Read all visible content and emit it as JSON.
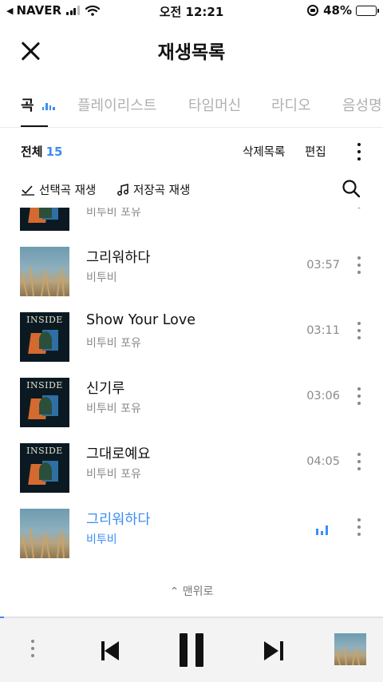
{
  "status_bar": {
    "carrier": "NAVER",
    "time": "오전 12:21",
    "battery": "48%",
    "battery_level": 0.48
  },
  "header": {
    "title": "재생목록"
  },
  "tabs": [
    {
      "label": "곡",
      "active": true
    },
    {
      "label": "플레이리스트",
      "active": false
    },
    {
      "label": "타임머신",
      "active": false
    },
    {
      "label": "라디오",
      "active": false
    },
    {
      "label": "음성명령",
      "active": false
    }
  ],
  "list_header": {
    "total_label": "전체",
    "total_count": "15",
    "delete_list_label": "삭제목록",
    "edit_label": "편집"
  },
  "actions": {
    "play_selected_label": "선택곡 재생",
    "play_saved_label": "저장곡 재생"
  },
  "tracks": [
    {
      "title": "",
      "artist": "비투비 포유",
      "duration": "",
      "art": "inside"
    },
    {
      "title": "그리워하다",
      "artist": "비투비",
      "duration": "03:57",
      "art": "grass"
    },
    {
      "title": "Show Your Love",
      "artist": "비투비 포유",
      "duration": "03:11",
      "art": "inside"
    },
    {
      "title": "신기루",
      "artist": "비투비 포유",
      "duration": "03:06",
      "art": "inside"
    },
    {
      "title": "그대로예요",
      "artist": "비투비 포유",
      "duration": "04:05",
      "art": "inside"
    },
    {
      "title": "그리워하다",
      "artist": "비투비",
      "duration": "",
      "art": "grass",
      "playing": true
    }
  ],
  "album_art": {
    "inside_title": "INSIDE"
  },
  "to_top_label": "맨위로",
  "player": {
    "progress": 0.01
  },
  "colors": {
    "accent": "#3a8ef6",
    "text": "#111111",
    "muted": "#8a8a8a",
    "player_bg": "#f3f3f3"
  }
}
